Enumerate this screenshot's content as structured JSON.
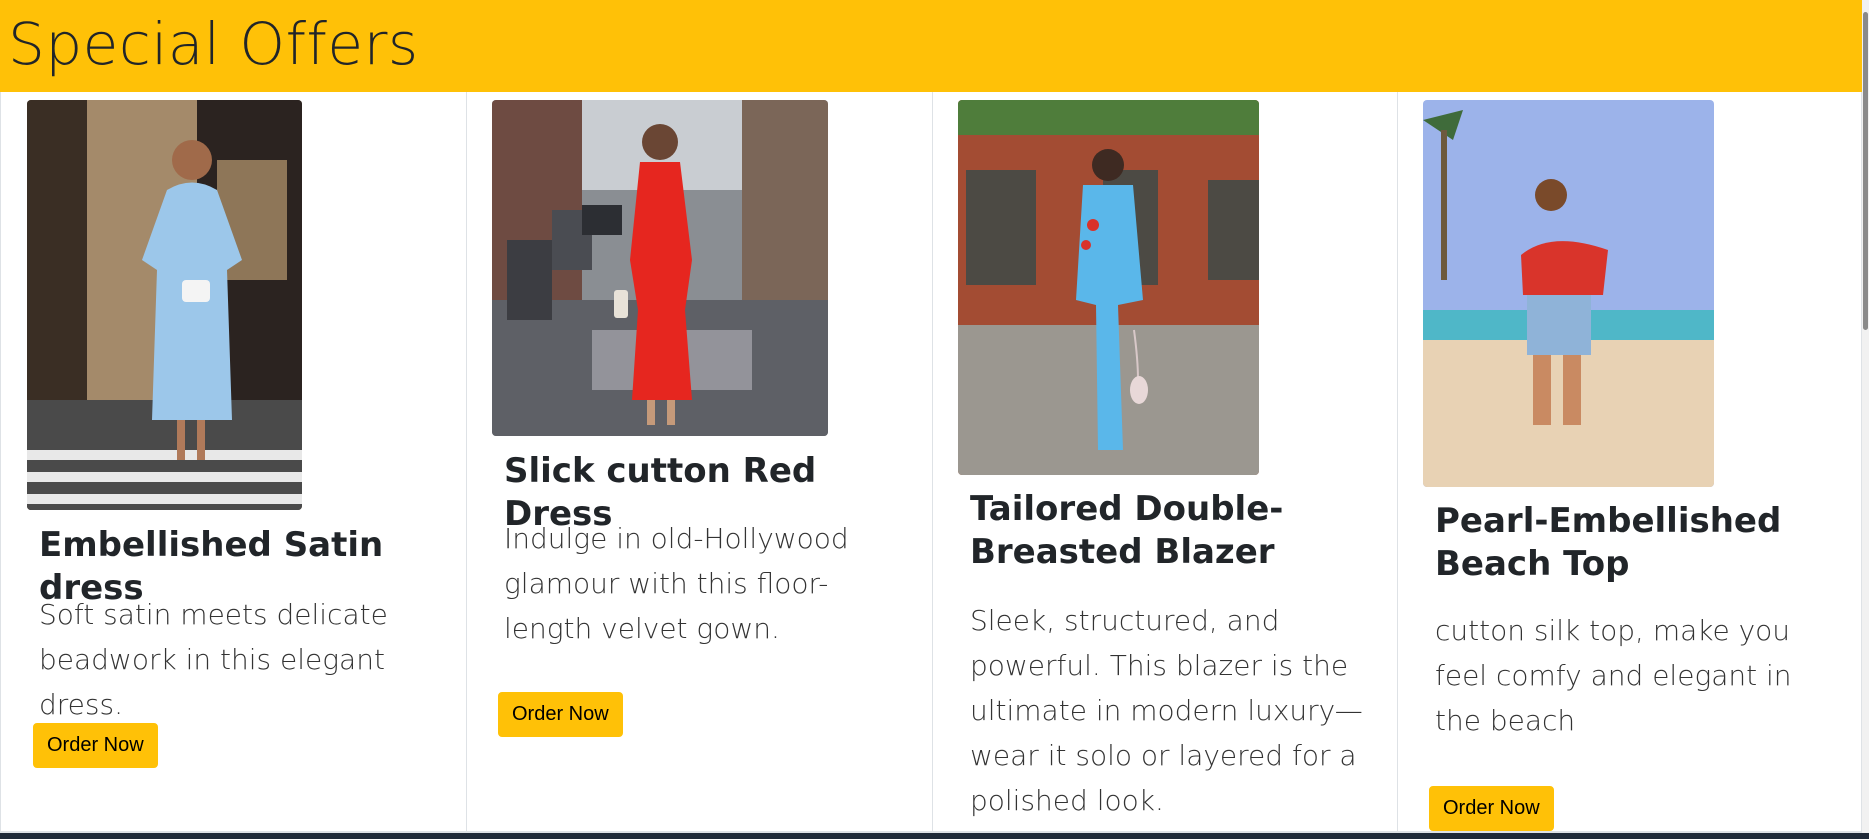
{
  "header": {
    "title": "Special Offers",
    "background": "#ffc107"
  },
  "products": [
    {
      "title": "Embellished Satin dress",
      "description": "Soft satin meets delicate beadwork in this elegant dress.",
      "button_label": "Order Now",
      "image": "woman in light blue puffed-sleeve satin dress on city crosswalk"
    },
    {
      "title": "Slick cutton Red Dress",
      "description": "Indulge in old-Hollywood glamour with this floor-length velvet gown.",
      "button_label": "Order Now",
      "image": "woman in long red bodycon dress on city street"
    },
    {
      "title": "Tailored Double-Breasted Blazer",
      "description": "Sleek, structured, and powerful. This blazer is the ultimate in modern luxury—wear it solo or layered for a polished look.",
      "button_label": "Order Now",
      "image": "woman in light blue floral suit in front of brick wall"
    },
    {
      "title": "Pearl-Embellished Beach Top",
      "description": "cutton silk top, make you feel comfy and elegant in the beach",
      "button_label": "Order Now",
      "image": "woman in red polka-dot top and denim shorts on beach"
    }
  ],
  "colors": {
    "accent": "#ffc107",
    "text": "#212529",
    "border": "#dee2e6"
  }
}
